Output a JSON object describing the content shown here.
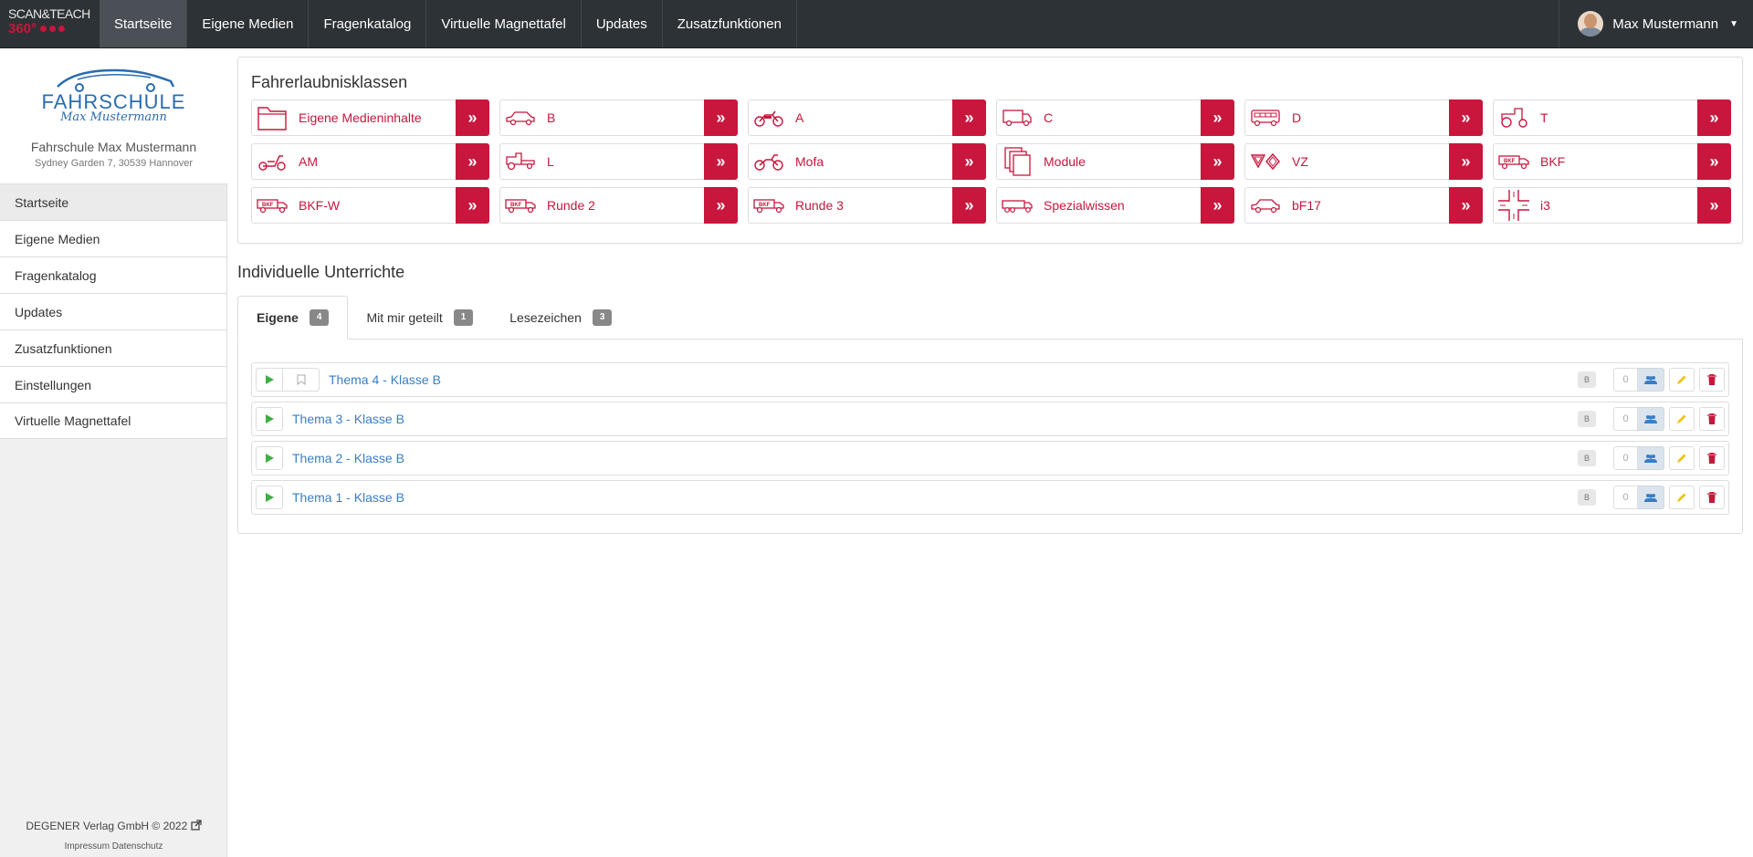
{
  "brand": {
    "line1": "SCAN&TEACH",
    "line2": "360°"
  },
  "nav": {
    "items": [
      {
        "label": "Startseite",
        "active": true
      },
      {
        "label": "Eigene Medien"
      },
      {
        "label": "Fragenkatalog"
      },
      {
        "label": "Virtuelle Magnettafel"
      },
      {
        "label": "Updates"
      },
      {
        "label": "Zusatzfunktionen"
      }
    ],
    "user_name": "Max Mustermann"
  },
  "sidebar": {
    "logo_text": "FAHRSCHULE",
    "logo_signature": "Max Mustermann",
    "school_name": "Fahrschule Max Mustermann",
    "school_address": "Sydney Garden 7, 30539 Hannover",
    "items": [
      {
        "label": "Startseite",
        "active": true
      },
      {
        "label": "Eigene Medien"
      },
      {
        "label": "Fragenkatalog"
      },
      {
        "label": "Updates"
      },
      {
        "label": "Zusatzfunktionen"
      },
      {
        "label": "Einstellungen"
      },
      {
        "label": "Virtuelle Magnettafel"
      }
    ],
    "copyright": "DEGENER Verlag GmbH © 2022",
    "footer_links": "Impressum Datenschutz"
  },
  "classes": {
    "title": "Fahrerlaubnisklassen",
    "items": [
      {
        "label": "Eigene Medieninhalte",
        "icon": "folder-icon"
      },
      {
        "label": "B",
        "icon": "car-icon"
      },
      {
        "label": "A",
        "icon": "motorcycle-icon"
      },
      {
        "label": "C",
        "icon": "truck-icon"
      },
      {
        "label": "D",
        "icon": "bus-icon"
      },
      {
        "label": "T",
        "icon": "tractor-icon"
      },
      {
        "label": "AM",
        "icon": "scooter-icon"
      },
      {
        "label": "L",
        "icon": "tractor-trailer-icon"
      },
      {
        "label": "Mofa",
        "icon": "moped-icon"
      },
      {
        "label": "Module",
        "icon": "documents-icon"
      },
      {
        "label": "VZ",
        "icon": "traffic-signs-icon"
      },
      {
        "label": "BKF",
        "icon": "bkf-truck-icon"
      },
      {
        "label": "BKF-W",
        "icon": "bkf-truck-icon"
      },
      {
        "label": "Runde 2",
        "icon": "bkf-truck-icon"
      },
      {
        "label": "Runde 3",
        "icon": "bkf-truck-icon"
      },
      {
        "label": "Spezialwissen",
        "icon": "semi-truck-icon"
      },
      {
        "label": "bF17",
        "icon": "car-icon"
      },
      {
        "label": "i3",
        "icon": "intersection-icon"
      }
    ],
    "arrow": "»"
  },
  "lessons": {
    "title": "Individuelle Unterrichte",
    "tabs": [
      {
        "label": "Eigene",
        "count": "4",
        "active": true
      },
      {
        "label": "Mit mir geteilt",
        "count": "1"
      },
      {
        "label": "Lesezeichen",
        "count": "3"
      }
    ],
    "rows": [
      {
        "title": "Thema 4 - Klasse B",
        "class_badge": "B",
        "share_count": "0",
        "bookmark": true
      },
      {
        "title": "Thema 3 - Klasse B",
        "class_badge": "B",
        "share_count": "0"
      },
      {
        "title": "Thema 2 - Klasse B",
        "class_badge": "B",
        "share_count": "0"
      },
      {
        "title": "Thema 1 - Klasse B",
        "class_badge": "B",
        "share_count": "0"
      }
    ]
  },
  "colors": {
    "accent": "#c8163c",
    "navbar": "#2d3236",
    "link": "#3a7ec4",
    "play": "#3cb043",
    "edit": "#f0c419"
  }
}
